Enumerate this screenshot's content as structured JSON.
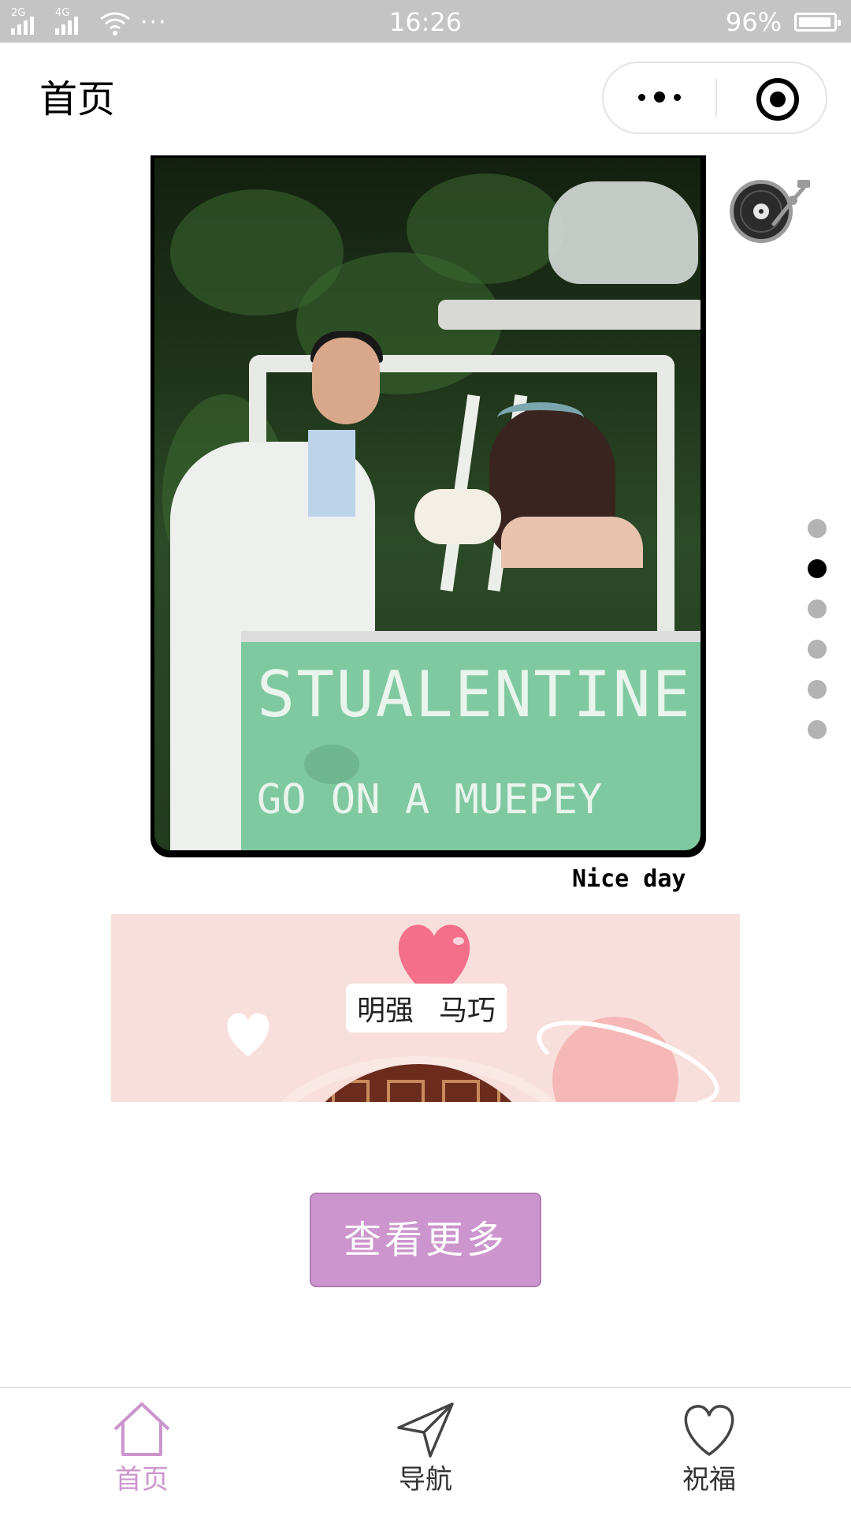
{
  "status_bar": {
    "network_1": "2G",
    "network_2": "4G",
    "more": "···",
    "time": "16:26",
    "battery_text": "96%",
    "battery_level": 0.96
  },
  "nav": {
    "title": "首页",
    "more_icon": "more-dots-icon",
    "close_icon": "target-circle-icon"
  },
  "photo": {
    "caption": "Nice day",
    "sign_line_1": "STUALENTINE",
    "sign_line_2": "GO ON A MUEPEY"
  },
  "music": {
    "icon": "record-player-icon"
  },
  "carousel": {
    "count": 6,
    "active_index": 1
  },
  "banner": {
    "groom_name": "明强",
    "bride_name": "马巧",
    "heart_color": "#f46f8a"
  },
  "buttons": {
    "view_more": "查看更多"
  },
  "tabbar": {
    "active_color": "#cc95cd",
    "items": [
      {
        "label": "首页",
        "icon": "home-icon"
      },
      {
        "label": "导航",
        "icon": "navigation-icon"
      },
      {
        "label": "祝福",
        "icon": "heart-icon"
      }
    ]
  }
}
